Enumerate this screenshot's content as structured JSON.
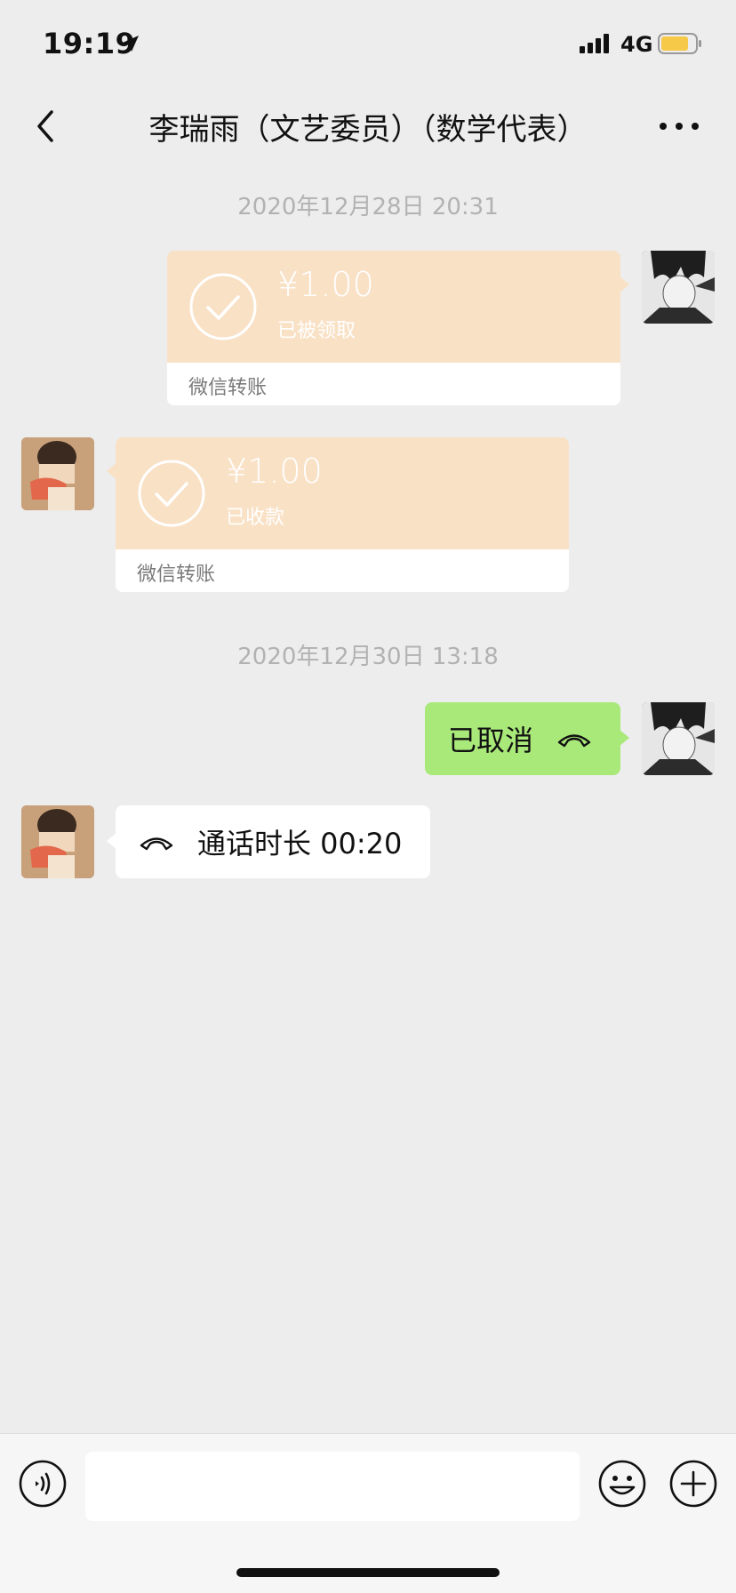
{
  "status_bar": {
    "time": "19:19",
    "network": "4G"
  },
  "nav": {
    "title": "李瑞雨（文艺委员）（数学代表）"
  },
  "messages": {
    "timestamp_1": "2020年12月28日 20:31",
    "transfer_1": {
      "amount": "¥1.00",
      "status": "已被领取",
      "footer": "微信转账"
    },
    "transfer_2": {
      "amount": "¥1.00",
      "status": "已收款",
      "footer": "微信转账"
    },
    "timestamp_2": "2020年12月30日 13:18",
    "call_1": {
      "text": "已取消"
    },
    "call_2": {
      "text": "通话时长 00:20"
    }
  },
  "input": {
    "value": "",
    "placeholder": ""
  },
  "colors": {
    "background": "#ededed",
    "transfer": "#f9e1c6",
    "sent_bubble": "#a9e97a",
    "battery": "#f7c948"
  },
  "icons": [
    "location-arrow-icon",
    "signal-icon",
    "battery-icon",
    "back-chevron-icon",
    "more-icon",
    "check-circle-icon",
    "hangup-phone-icon",
    "voice-icon",
    "emoji-icon",
    "plus-icon"
  ]
}
